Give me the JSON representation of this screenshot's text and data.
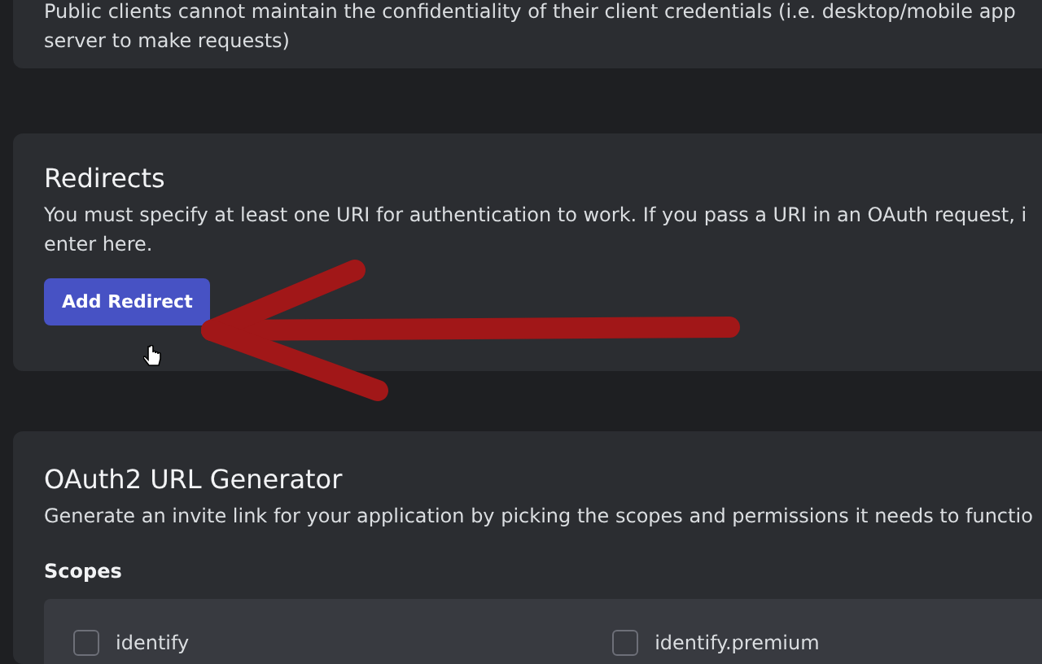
{
  "public_client": {
    "lines": [
      "Public clients cannot maintain the confidentiality of their client credentials (i.e. desktop/mobile app",
      "server to make requests)"
    ]
  },
  "redirects": {
    "title": "Redirects",
    "lines": [
      "You must specify at least one URI for authentication to work. If you pass a URI in an OAuth request, i",
      "enter here."
    ],
    "button": "Add Redirect"
  },
  "url_generator": {
    "title": "OAuth2 URL Generator",
    "description": "Generate an invite link for your application by picking the scopes and permissions it needs to functio",
    "scopes_label": "Scopes",
    "scopes": [
      {
        "label": "identify",
        "checked": false
      },
      {
        "label": "identify.premium",
        "checked": false
      }
    ]
  }
}
